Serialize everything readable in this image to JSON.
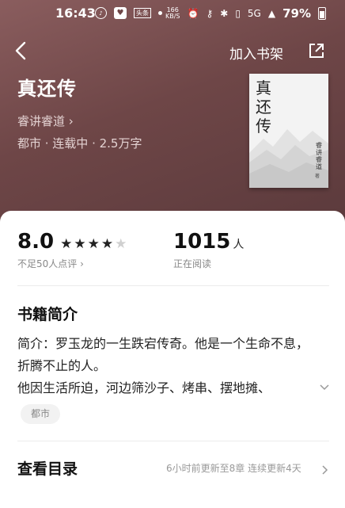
{
  "status_bar": {
    "time": "16:43",
    "badge": "头条",
    "net_speed": "166",
    "net_speed_unit": "KB/S",
    "signal": "5G",
    "battery": "79%"
  },
  "nav": {
    "add_to_shelf": "加入书架"
  },
  "book": {
    "title": "真还传",
    "author": "睿讲睿道",
    "meta": "都市 · 连载中 · 2.5万字",
    "cover": {
      "title": "真还传",
      "author": "睿讲睿道",
      "suffix": "著"
    }
  },
  "stats": {
    "score": "8.0",
    "stars_filled": 4,
    "stars_total": 5,
    "rating_note": "不足50人点评",
    "readers": "1015",
    "readers_unit": "人",
    "readers_note": "正在阅读"
  },
  "intro": {
    "heading": "书籍简介",
    "line1": "简介：罗玉龙的一生跌宕传奇。他是一个生命不息，",
    "line2": "折腾不止的人。",
    "line3": "他因生活所迫，河边筛沙子、烤串、摆地摊、",
    "tag": "都市"
  },
  "toc": {
    "heading": "查看目录",
    "update": "6小时前更新至8章 连续更新4天"
  },
  "colors": {
    "hero_top": "#8a5d5e",
    "hero_bottom": "#5b3a3c"
  }
}
